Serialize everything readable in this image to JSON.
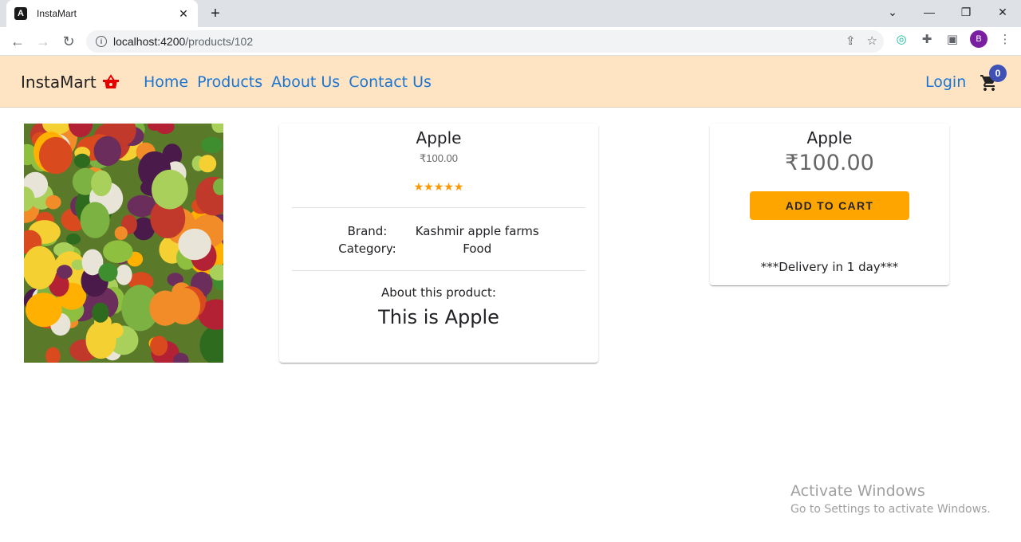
{
  "browser": {
    "tab_title": "InstaMart",
    "url_host": "localhost:4200",
    "url_path": "/products/102"
  },
  "header": {
    "brand": "InstaMart",
    "nav": [
      "Home",
      "Products",
      "About Us",
      "Contact Us"
    ],
    "login": "Login",
    "cart_count": "0"
  },
  "product": {
    "name": "Apple",
    "price": "₹100.00",
    "rating": 5,
    "brand_label": "Brand:",
    "brand_value": "Kashmir apple farms",
    "category_label": "Category:",
    "category_value": "Food",
    "about_label": "About this product:",
    "about_text": "This is Apple"
  },
  "buy_box": {
    "name": "Apple",
    "price": "₹100.00",
    "add_to_cart": "ADD TO CART",
    "delivery": "***Delivery in 1 day***"
  },
  "watermark": {
    "title": "Activate Windows",
    "subtitle": "Go to Settings to activate Windows."
  },
  "colors": {
    "header_bg": "#ffe4c4",
    "link": "#1976d2",
    "accent_button": "#ffa500",
    "badge": "#3f51b5",
    "star": "#ff9800"
  }
}
